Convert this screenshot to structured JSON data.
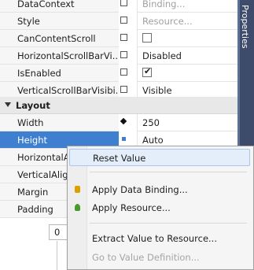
{
  "panel_title": "Properties",
  "rows_top": [
    {
      "name": "DataContext",
      "value": "Binding...",
      "kind": "muted"
    },
    {
      "name": "Style",
      "value": "Resource...",
      "kind": "muted"
    },
    {
      "name": "CanContentScroll",
      "value": "",
      "kind": "checkbox",
      "checked": false
    },
    {
      "name": "HorizontalScrollBarVi...",
      "value": "Disabled",
      "kind": "text"
    },
    {
      "name": "IsEnabled",
      "value": "",
      "kind": "checkbox",
      "checked": true
    },
    {
      "name": "VerticalScrollBarVisibi...",
      "value": "Visible",
      "kind": "text"
    }
  ],
  "category": "Layout",
  "rows_layout": [
    {
      "name": "Width",
      "value": "250"
    },
    {
      "name": "Height",
      "value": "Auto"
    },
    {
      "name": "HorizontalA",
      "value": ""
    },
    {
      "name": "VerticalAlig",
      "value": ""
    },
    {
      "name": "Margin",
      "value": ""
    },
    {
      "name": "Padding",
      "value": ""
    }
  ],
  "under_value": "0",
  "context_menu": {
    "reset": "Reset Value",
    "apply_binding": "Apply Data Binding...",
    "apply_resource": "Apply Resource...",
    "extract": "Extract Value to Resource...",
    "goto": "Go to Value Definition..."
  },
  "colors": {
    "selection": "#3f7fd0",
    "binding_icon": "#d9a000",
    "resource_icon": "#4a9a2a",
    "panel_tab": "#3e4b6a"
  }
}
